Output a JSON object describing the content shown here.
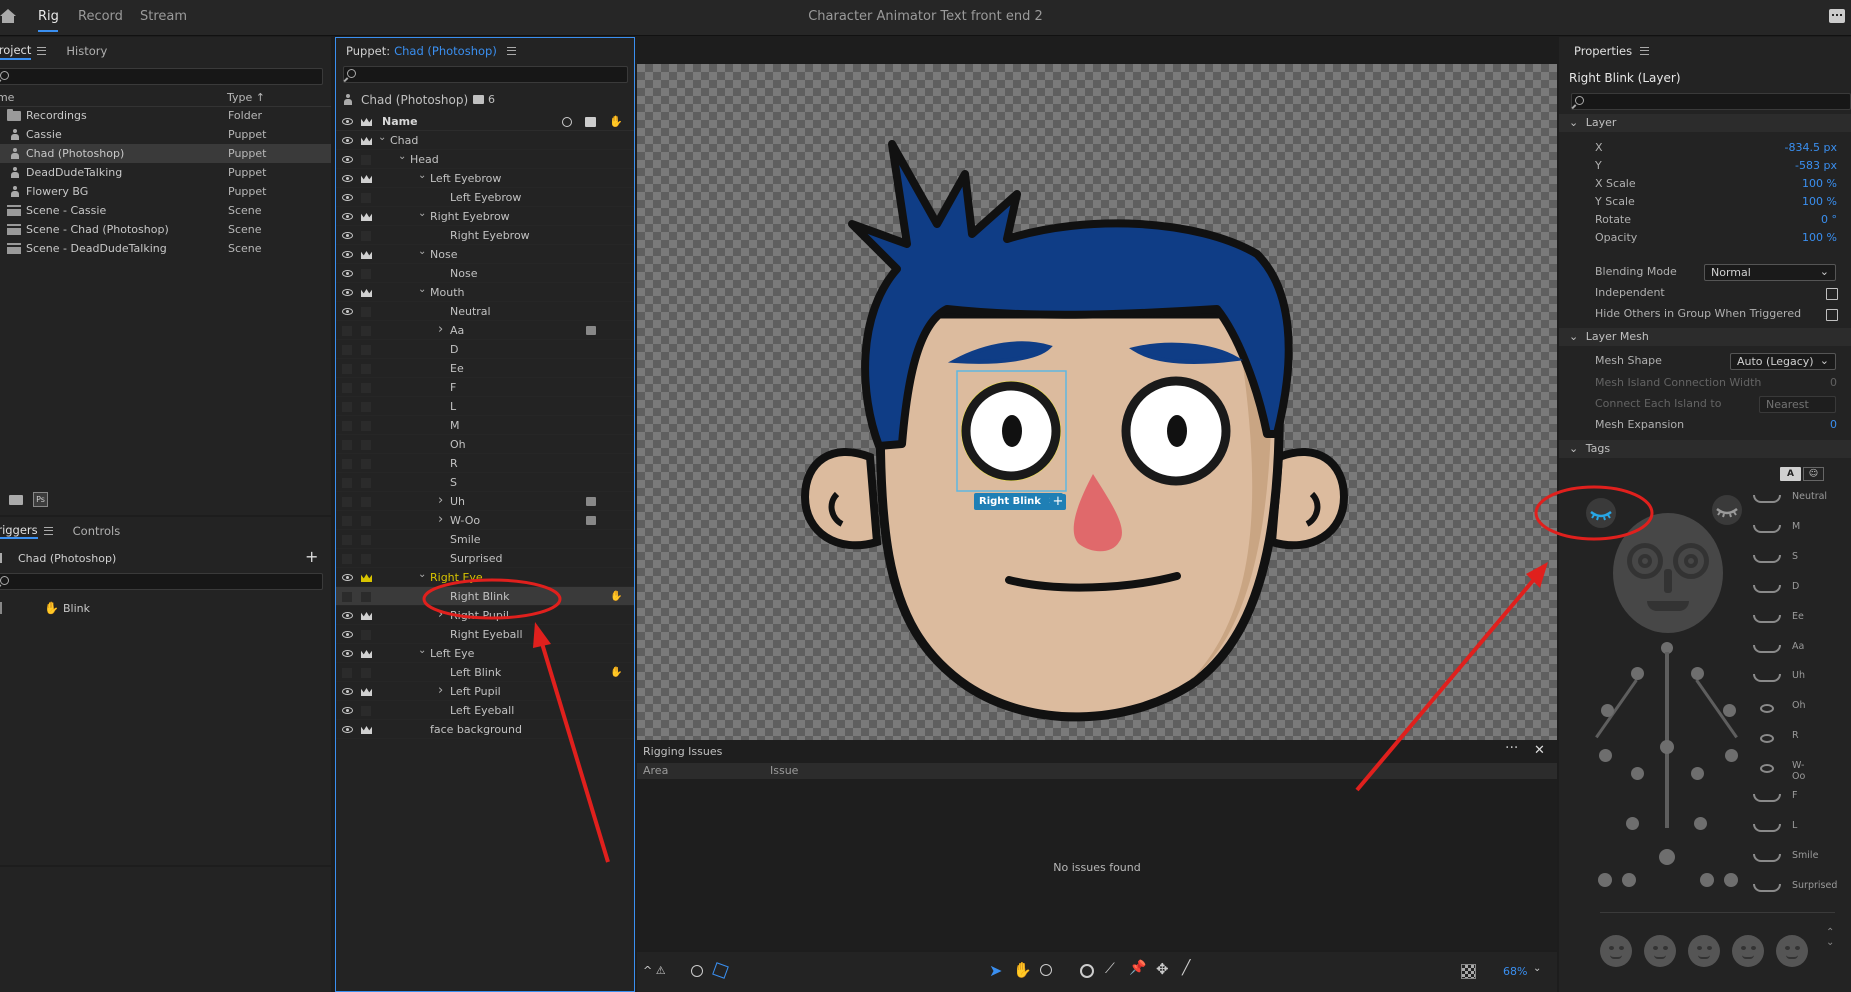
{
  "app": {
    "title": "Character Animator Text front end 2"
  },
  "topnav": {
    "tabs": [
      "Rig",
      "Record",
      "Stream"
    ]
  },
  "project": {
    "tabs": [
      "Project",
      "History"
    ],
    "columns": {
      "name": "Name",
      "type": "Type"
    },
    "items": [
      {
        "name": "Recordings",
        "type": "Folder",
        "icon": "folder-icon"
      },
      {
        "name": "Cassie",
        "type": "Puppet",
        "icon": "puppet-icon"
      },
      {
        "name": "Chad (Photoshop)",
        "type": "Puppet",
        "icon": "puppet-icon",
        "selected": true
      },
      {
        "name": "DeadDudeTalking",
        "type": "Puppet",
        "icon": "puppet-icon"
      },
      {
        "name": "Flowery BG",
        "type": "Puppet",
        "icon": "puppet-icon"
      },
      {
        "name": "Scene - Cassie",
        "type": "Scene",
        "icon": "scene-icon"
      },
      {
        "name": "Scene - Chad (Photoshop)",
        "type": "Scene",
        "icon": "scene-icon"
      },
      {
        "name": "Scene - DeadDudeTalking",
        "type": "Scene",
        "icon": "scene-icon"
      }
    ],
    "ps_badge": "Ps"
  },
  "triggers": {
    "tabs": [
      "Triggers",
      "Controls"
    ],
    "puppet": "Chad (Photoshop)",
    "items": [
      {
        "name": "Blink"
      }
    ]
  },
  "puppet_panel": {
    "label": "Puppet:",
    "name": "Chad (Photoshop)",
    "header_name": "Chad (Photoshop)",
    "count": "6",
    "column_name": "Name",
    "layers": [
      {
        "name": "Chad",
        "depth": 1,
        "chevron": "down",
        "eye": true,
        "crown": true
      },
      {
        "name": "Head",
        "depth": 2,
        "chevron": "down",
        "eye": true,
        "crown": false
      },
      {
        "name": "Left Eyebrow",
        "depth": 3,
        "chevron": "down",
        "eye": true,
        "crown": true
      },
      {
        "name": "Left Eyebrow",
        "depth": 4,
        "eye": true
      },
      {
        "name": "Right Eyebrow",
        "depth": 3,
        "chevron": "down",
        "eye": true,
        "crown": true
      },
      {
        "name": "Right Eyebrow",
        "depth": 4,
        "eye": true
      },
      {
        "name": "Nose",
        "depth": 3,
        "chevron": "down",
        "eye": true,
        "crown": true
      },
      {
        "name": "Nose",
        "depth": 4,
        "eye": true
      },
      {
        "name": "Mouth",
        "depth": 3,
        "chevron": "down",
        "eye": true,
        "crown": true
      },
      {
        "name": "Neutral",
        "depth": 4,
        "eye": true
      },
      {
        "name": "Aa",
        "depth": 4,
        "chevron": "right",
        "eye": false,
        "badge": true
      },
      {
        "name": "D",
        "depth": 4,
        "eye": false
      },
      {
        "name": "Ee",
        "depth": 4,
        "eye": false
      },
      {
        "name": "F",
        "depth": 4,
        "eye": false
      },
      {
        "name": "L",
        "depth": 4,
        "eye": false
      },
      {
        "name": "M",
        "depth": 4,
        "eye": false
      },
      {
        "name": "Oh",
        "depth": 4,
        "eye": false
      },
      {
        "name": "R",
        "depth": 4,
        "eye": false
      },
      {
        "name": "S",
        "depth": 4,
        "eye": false
      },
      {
        "name": "Uh",
        "depth": 4,
        "chevron": "right",
        "eye": false,
        "badge": true
      },
      {
        "name": "W-Oo",
        "depth": 4,
        "chevron": "right",
        "eye": false,
        "badge": true
      },
      {
        "name": "Smile",
        "depth": 4,
        "eye": false
      },
      {
        "name": "Surprised",
        "depth": 4,
        "eye": false
      },
      {
        "name": "Right Eye",
        "depth": 3,
        "chevron": "down",
        "eye": true,
        "crown": true,
        "highlight": true
      },
      {
        "name": "Right Blink",
        "depth": 4,
        "eye": false,
        "selected": true,
        "trigger": true
      },
      {
        "name": "Right Pupil",
        "depth": 4,
        "chevron": "right",
        "eye": true,
        "crown": true
      },
      {
        "name": "Right Eyeball",
        "depth": 4,
        "eye": true
      },
      {
        "name": "Left Eye",
        "depth": 3,
        "chevron": "down",
        "eye": true,
        "crown": true
      },
      {
        "name": "Left Blink",
        "depth": 4,
        "eye": false,
        "trigger": true
      },
      {
        "name": "Left Pupil",
        "depth": 4,
        "chevron": "right",
        "eye": true,
        "crown": true
      },
      {
        "name": "Left Eyeball",
        "depth": 4,
        "eye": true
      },
      {
        "name": "face background",
        "depth": 3,
        "eye": true,
        "crown": true
      }
    ]
  },
  "canvas": {
    "tag_chip": "Right Blink",
    "zoom": "68%"
  },
  "rigging_issues": {
    "title": "Rigging Issues",
    "columns": [
      "Area",
      "Issue"
    ],
    "empty_message": "No issues found"
  },
  "properties": {
    "title": "Properties",
    "layer_title": "Right Blink (Layer)",
    "layer_section": "Layer",
    "rows": [
      {
        "label": "X",
        "value": "-834.5 px"
      },
      {
        "label": "Y",
        "value": "-583 px"
      },
      {
        "label": "X Scale",
        "value": "100 %"
      },
      {
        "label": "Y Scale",
        "value": "100 %"
      },
      {
        "label": "Rotate",
        "value": "0 °"
      },
      {
        "label": "Opacity",
        "value": "100 %"
      }
    ],
    "blending_mode_label": "Blending Mode",
    "blending_mode_value": "Normal",
    "independent_label": "Independent",
    "hide_others_label": "Hide Others in Group When Triggered",
    "mesh_section": "Layer Mesh",
    "mesh_shape_label": "Mesh Shape",
    "mesh_shape_value": "Auto (Legacy)",
    "mesh_island_label": "Mesh Island Connection Width",
    "mesh_island_value": "0",
    "connect_each_label": "Connect Each Island to",
    "connect_each_value": "Nearest",
    "mesh_expansion_label": "Mesh Expansion",
    "mesh_expansion_value": "0",
    "tags_section": "Tags",
    "tags_mode": "A",
    "mouth_tags": [
      "Neutral",
      "M",
      "S",
      "D",
      "Ee",
      "Aa",
      "Uh",
      "Oh",
      "R",
      "W-Oo",
      "F",
      "L",
      "Smile",
      "Surprised"
    ]
  },
  "colors": {
    "accent": "#3a8ff0",
    "hair": "#0f3d86",
    "skin": "#dcbb9e",
    "nose": "#e0696b",
    "annotation": "#e0201d",
    "highlight_layer": "#d8c400"
  }
}
